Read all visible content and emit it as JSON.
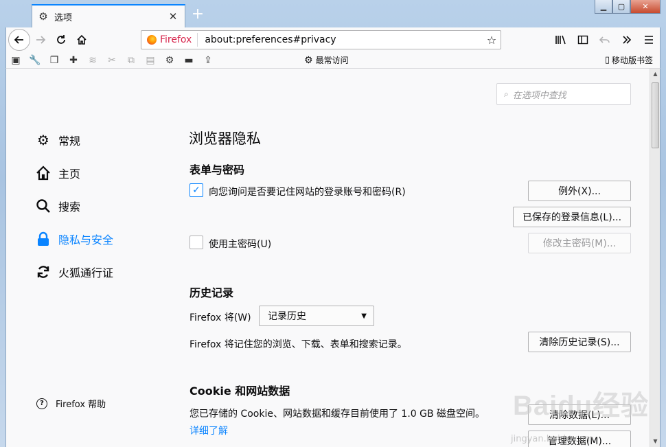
{
  "tab": {
    "title": "选项",
    "close": "✕"
  },
  "urlbar": {
    "brand": "Firefox",
    "url": "about:preferences#privacy"
  },
  "bookmarks": {
    "folder": "最常访问",
    "mobile": "移动版书签"
  },
  "search": {
    "placeholder": "在选项中查找"
  },
  "sidebar": {
    "items": [
      {
        "label": "常规",
        "icon": "gear-icon"
      },
      {
        "label": "主页",
        "icon": "home-icon"
      },
      {
        "label": "搜索",
        "icon": "search-icon"
      },
      {
        "label": "隐私与安全",
        "icon": "lock-icon"
      },
      {
        "label": "火狐通行证",
        "icon": "sync-icon"
      }
    ],
    "help": "Firefox 帮助"
  },
  "main": {
    "title": "浏览器隐私",
    "forms": {
      "heading": "表单与密码",
      "remember_label": "向您询问是否要记住网站的登录账号和密码(R)",
      "remember_checked": true,
      "exceptions_button": "例外(X)...",
      "saved_logins_button": "已保存的登录信息(L)...",
      "master_label": "使用主密码(U)",
      "master_checked": false,
      "change_master_button": "修改主密码(M)..."
    },
    "history": {
      "heading": "历史记录",
      "will_label": "Firefox 将(W)",
      "mode_value": "记录历史",
      "description": "Firefox 将记住您的浏览、下载、表单和搜索记录。",
      "clear_button": "清除历史记录(S)..."
    },
    "cookies": {
      "heading": "Cookie 和网站数据",
      "description": "您已存储的 Cookie、网站数据和缓存目前使用了 1.0 GB 磁盘空间。",
      "learn_more": "详细了解",
      "clear_button": "清除数据(L)...",
      "manage_button": "管理数据(M)..."
    }
  },
  "watermark": {
    "text": "Baidu经验",
    "sub": "jingyan.baidu.com"
  },
  "colors": {
    "accent": "#0a84ff",
    "brand": "#d7264d"
  }
}
